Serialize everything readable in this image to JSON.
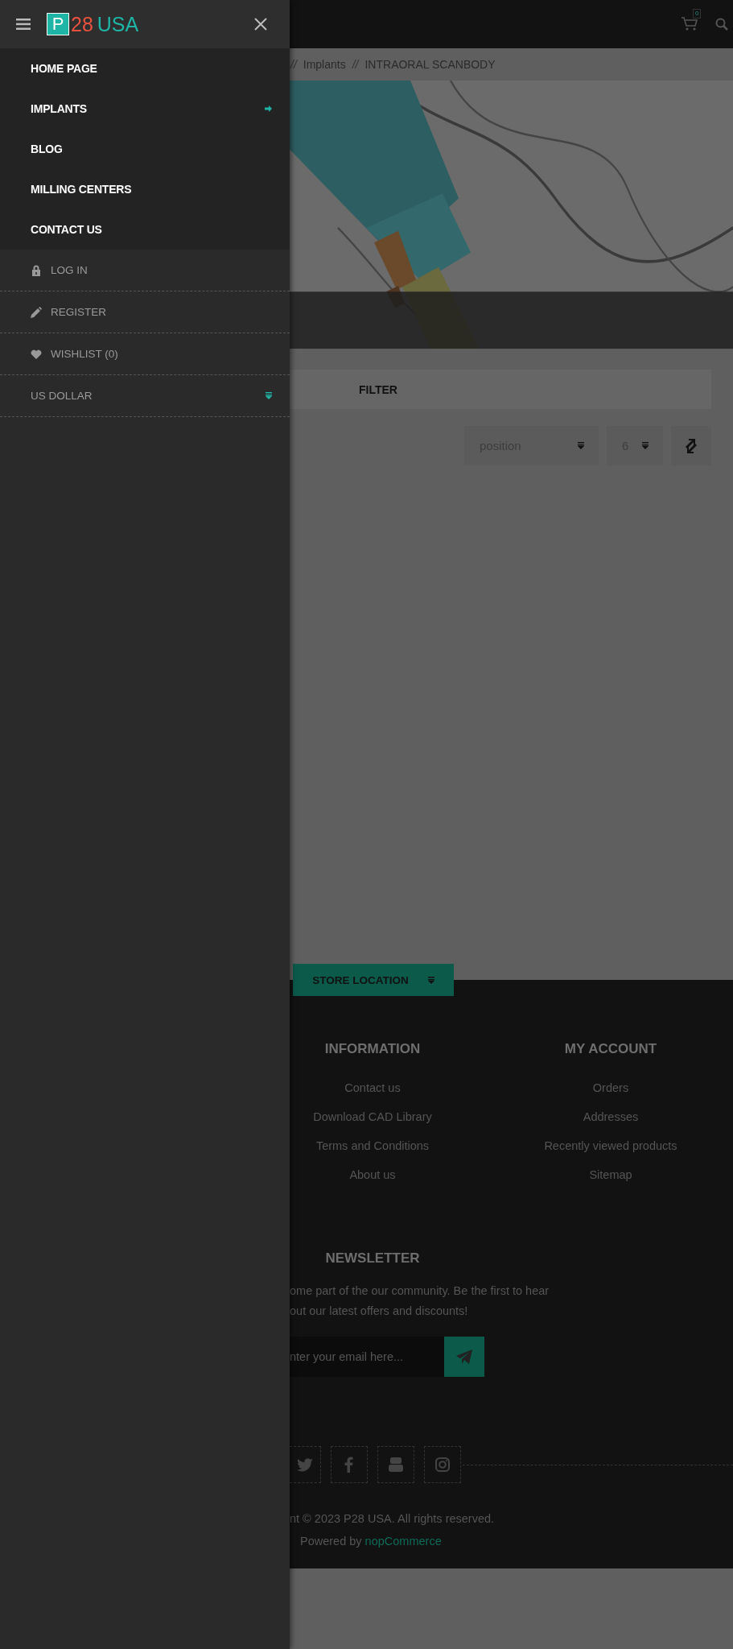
{
  "drawer": {
    "logo": {
      "mark": "P",
      "number": "28",
      "name": "USA"
    },
    "menu": [
      {
        "label": "HOME PAGE",
        "has_submenu": false
      },
      {
        "label": "IMPLANTS",
        "has_submenu": true
      },
      {
        "label": "BLOG",
        "has_submenu": false
      },
      {
        "label": "MILLING CENTERS",
        "has_submenu": false
      },
      {
        "label": "CONTACT US",
        "has_submenu": false
      }
    ],
    "account": [
      {
        "label": "LOG IN",
        "kind": "login"
      },
      {
        "label": "REGISTER",
        "kind": "register"
      },
      {
        "label": "WISHLIST (0)",
        "kind": "wishlist"
      },
      {
        "label": "US DOLLAR",
        "kind": "currency"
      }
    ]
  },
  "header": {
    "cart_count": "0"
  },
  "breadcrumb": {
    "separator": "//",
    "items": [
      "Implants",
      "INTRAORAL SCANBODY"
    ]
  },
  "toolbar": {
    "filter": "FILTER",
    "sort": "position",
    "page_size": "6"
  },
  "footer": {
    "store_location": "STORE LOCATION",
    "columns": [
      {
        "title": "INFORMATION",
        "links": [
          "Contact us",
          "Download CAD Library",
          "Terms and Conditions",
          "About us"
        ]
      },
      {
        "title": "MY ACCOUNT",
        "links": [
          "Orders",
          "Addresses",
          "Recently viewed products",
          "Sitemap"
        ]
      }
    ],
    "newsletter": {
      "title": "NEWSLETTER",
      "text": "ome part of the our community. Be the first to hear out our latest offers and discounts!",
      "placeholder": "nter your email here..."
    },
    "copyright": "nt © 2023 P28 USA. All rights reserved.",
    "powered_by": {
      "text": "Powered by",
      "link": "nopCommerce"
    }
  }
}
